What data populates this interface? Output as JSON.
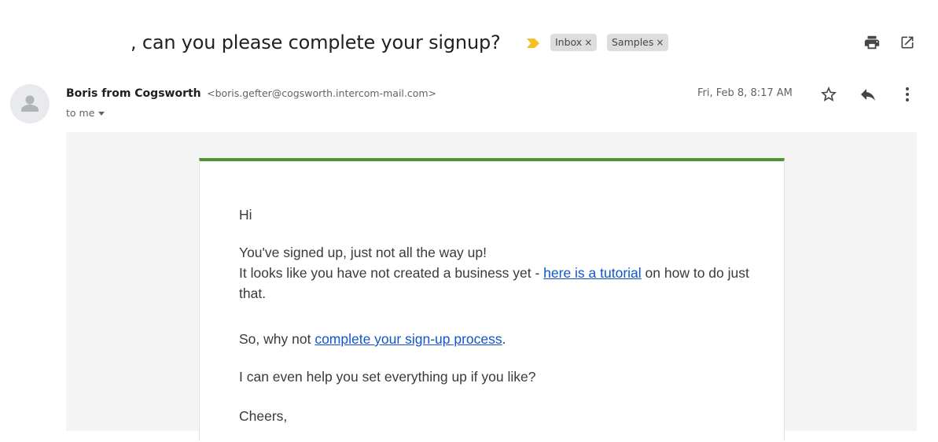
{
  "subject": {
    "title": ", can you please complete your signup?",
    "labels": [
      {
        "name": "Inbox",
        "remove": "×"
      },
      {
        "name": "Samples",
        "remove": "×"
      }
    ]
  },
  "toolbar": {
    "icons": [
      "print-icon",
      "open-in-new-window-icon"
    ]
  },
  "header": {
    "sender_name": "Boris from Cogsworth",
    "sender_email": "<boris.gefter@cogsworth.intercom-mail.com>",
    "to": "to me",
    "date": "Fri, Feb 8, 8:17 AM",
    "icons": [
      "star-icon",
      "reply-icon",
      "more-vert-icon"
    ]
  },
  "message": {
    "greeting": "Hi",
    "line1": "You've signed up, just not all the way up!",
    "line2_before": "It looks like you have not created a business yet - ",
    "line2_link": "here is a tutorial",
    "line2_after": " on how to do just that.",
    "line3_before": "So, why not ",
    "line3_link": "complete your sign-up process",
    "line3_after": ".",
    "line4": "I can even help you set everything up if you like?",
    "signoff": "Cheers,"
  },
  "colors": {
    "accent_bar": "#4b9537",
    "link": "#1155cc",
    "importance_marker": "#f6c026",
    "body_background": "#f4f4f4"
  }
}
